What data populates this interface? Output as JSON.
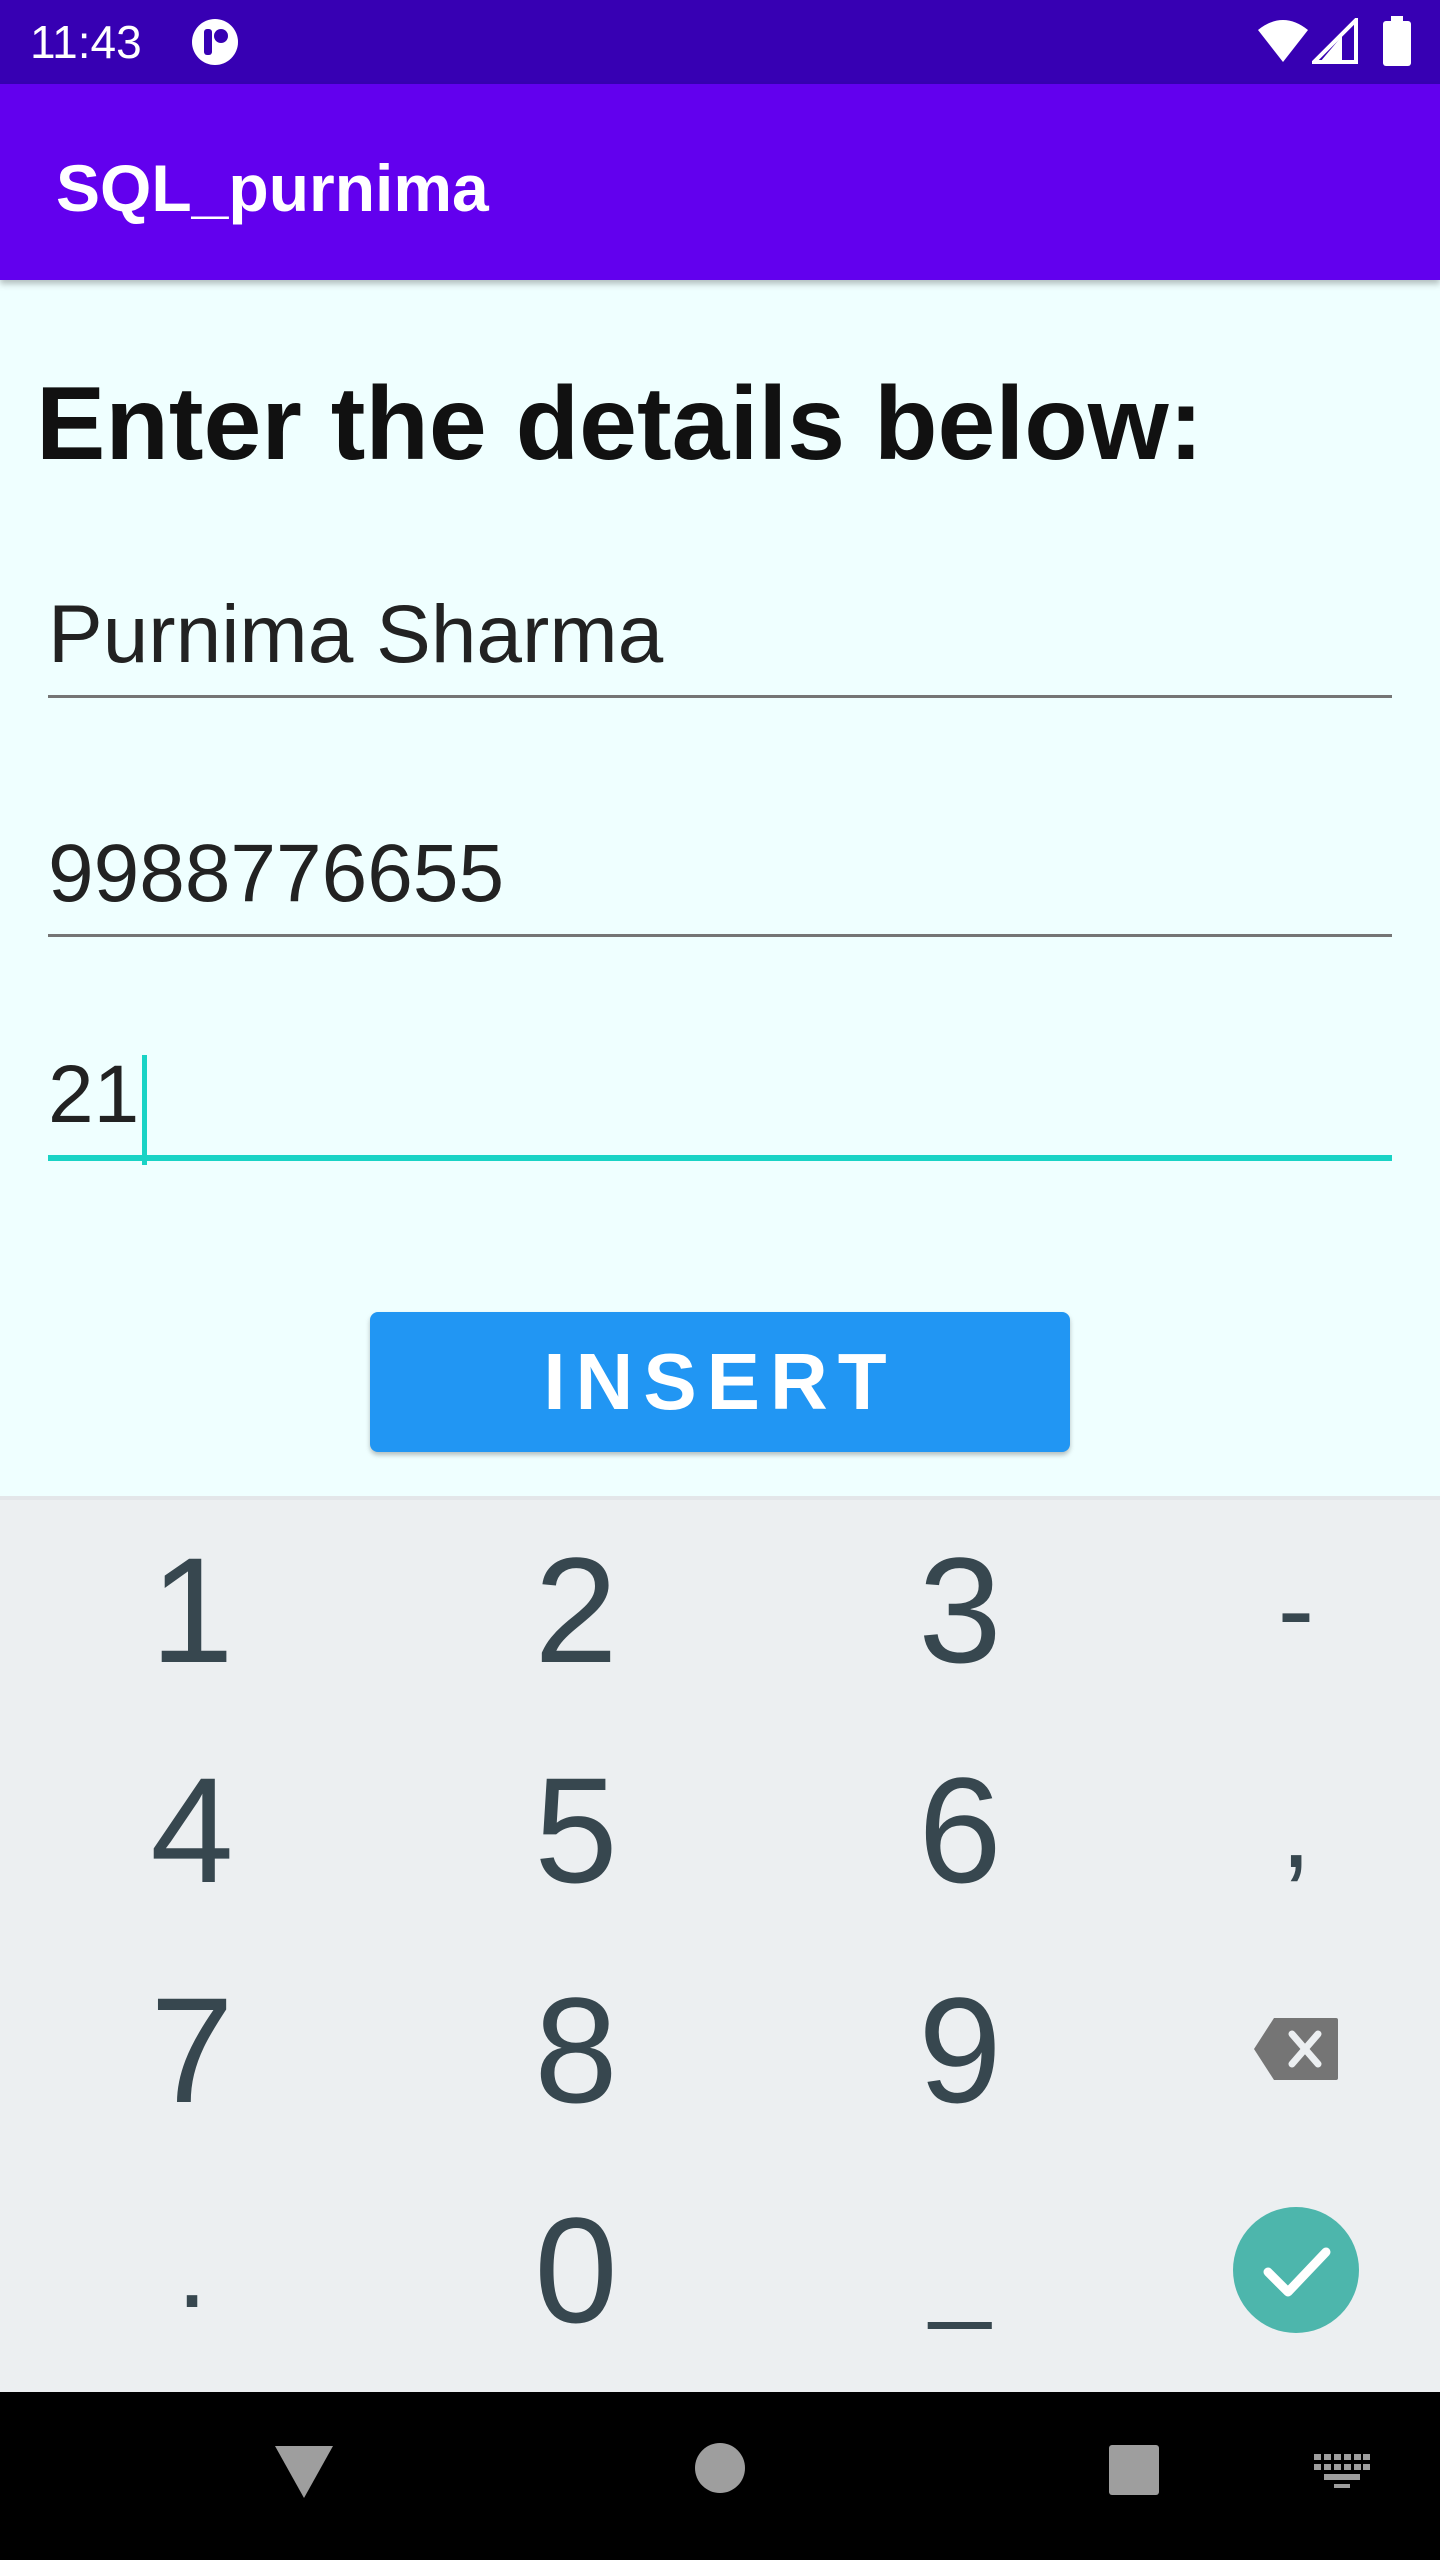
{
  "status_bar": {
    "time": "11:43",
    "icons": [
      "app-notification-icon",
      "wifi-icon",
      "signal-icon",
      "battery-icon"
    ]
  },
  "app_bar": {
    "title": "SQL_purnima"
  },
  "form": {
    "heading": "Enter the details below:",
    "name_value": "Purnima Sharma",
    "phone_value": "9988776655",
    "age_value": "21",
    "insert_label": "INSERT"
  },
  "keyboard": {
    "keys": [
      "1",
      "2",
      "3",
      "-",
      "4",
      "5",
      "6",
      ",",
      "7",
      "8",
      "9",
      "backspace",
      ".",
      "0",
      "_",
      "done"
    ],
    "accent_color": "#4db6ac"
  },
  "colors": {
    "status_bar": "#3700b3",
    "app_bar": "#6200ee",
    "background": "#efffff",
    "button": "#2196f3",
    "focus": "#19d3c5"
  }
}
